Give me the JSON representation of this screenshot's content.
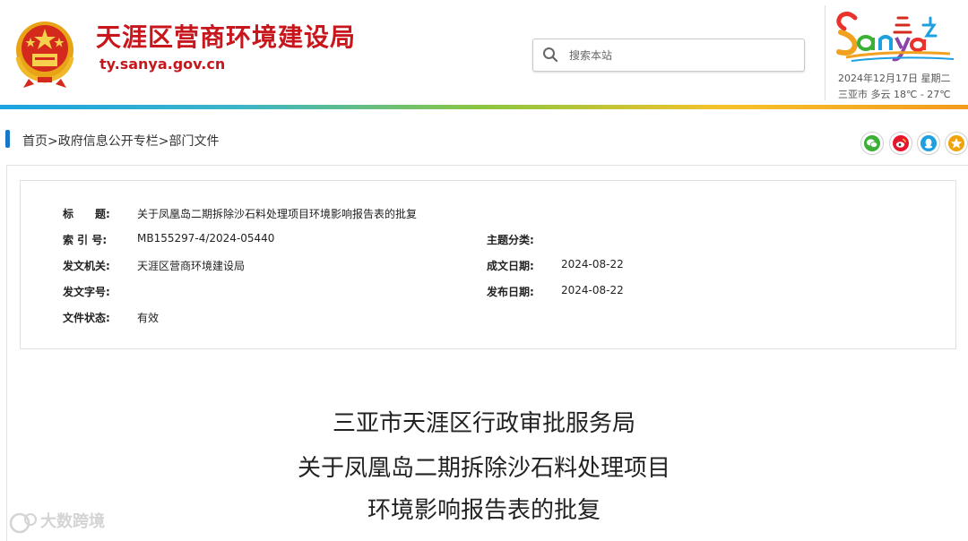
{
  "header": {
    "site_title": "天涯区营商环境建设局",
    "site_url": "ty.sanya.gov.cn",
    "search_placeholder": "搜索本站",
    "logo_wordmark": "Sanya 三亚",
    "date": "2024年12月17日 星期二",
    "weather": "三亚市 多云 18℃ - 27℃"
  },
  "breadcrumb": {
    "home": "首页",
    "sep1": ">",
    "column": "政府信息公开专栏",
    "sep2": ">",
    "current": "部门文件"
  },
  "share_icons": [
    "wechat-icon",
    "weibo-icon",
    "qq-icon",
    "favorite-icon"
  ],
  "colors": {
    "brand_red": "#c8161d",
    "breadcrumb_accent": "#1677c8",
    "wechat": "#3cb034",
    "weibo": "#e6162d",
    "qq": "#1ea0e0",
    "favorite": "#f0a30a"
  },
  "meta": {
    "title_label": "标　　题:",
    "title_value": "关于凤凰岛二期拆除沙石料处理项目环境影响报告表的批复",
    "index_label": "索  引  号:",
    "index_value": "MB155297-4/2024-05440",
    "category_label": "主题分类:",
    "category_value": "",
    "issuer_label": "发文机关:",
    "issuer_value": "天涯区营商环境建设局",
    "created_label": "成文日期:",
    "created_value": "2024-08-22",
    "docno_label": "发文字号:",
    "docno_value": "",
    "published_label": "发布日期:",
    "published_value": "2024-08-22",
    "status_label": "文件状态:",
    "status_value": "有效"
  },
  "document": {
    "title_line1": "三亚市天涯区行政审批服务局",
    "title_line2": "关于凤凰岛二期拆除沙石料处理项目",
    "title_line3": "环境影响报告表的批复"
  },
  "watermark": "大数跨境"
}
